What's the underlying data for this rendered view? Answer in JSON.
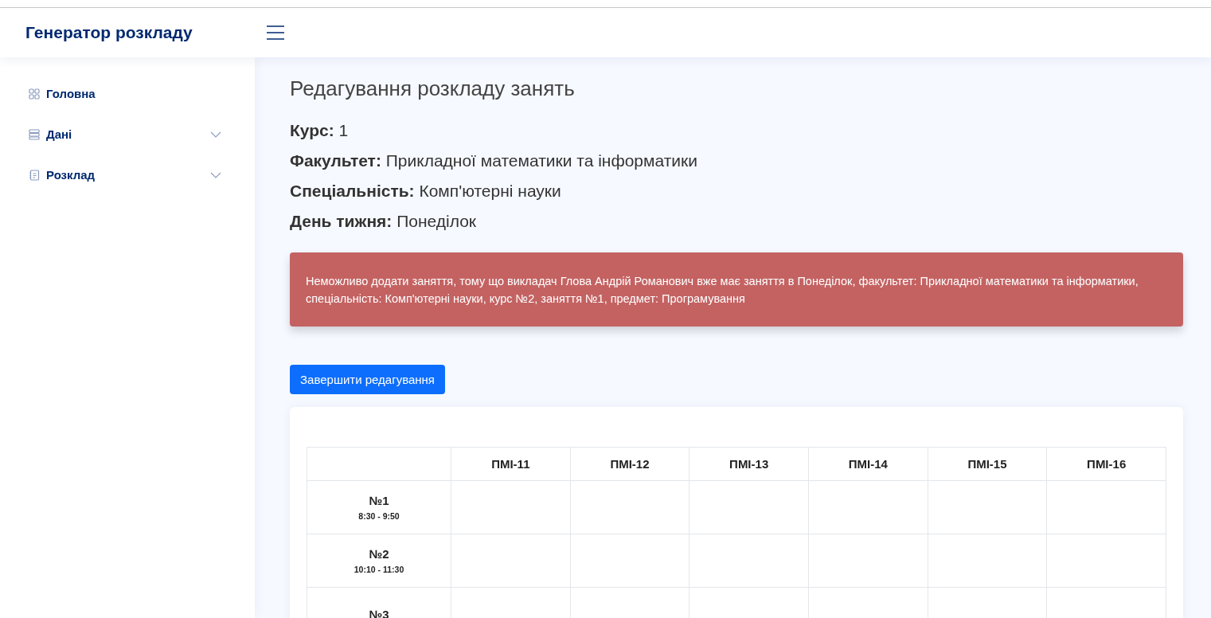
{
  "header": {
    "logo": "Генератор розкладу"
  },
  "sidebar": {
    "items": [
      {
        "label": "Головна",
        "kind": "link"
      },
      {
        "label": "Дані",
        "kind": "dropdown"
      },
      {
        "label": "Розклад",
        "kind": "dropdown"
      }
    ]
  },
  "page": {
    "title": "Редагування розкладу занять",
    "info": [
      "**Курс:** 1",
      "**Факультет:** Прикладної математики та інформатики",
      "**Спеціальність:** Комп'ютерні науки",
      "**День тижня:** Понеділок"
    ],
    "alert": "Неможливо додати заняття, тому що викладач Глова Андрій Романович вже має заняття в Понеділок, факультет: Прикладної математики та інформатики, спеціальність: Комп'ютерні науки, курс №2, заняття №1, предмет: Програмування",
    "finish_button": "Завершити редагування"
  },
  "table": {
    "columns": [
      "ПМІ-11",
      "ПМІ-12",
      "ПМІ-13",
      "ПМІ-14",
      "ПМІ-15",
      "ПМІ-16"
    ],
    "rows": [
      {
        "number": "№1",
        "time": "8:30 - 9:50"
      },
      {
        "number": "№2",
        "time": "10:10 - 11:30"
      },
      {
        "number": "№3"
      }
    ]
  }
}
